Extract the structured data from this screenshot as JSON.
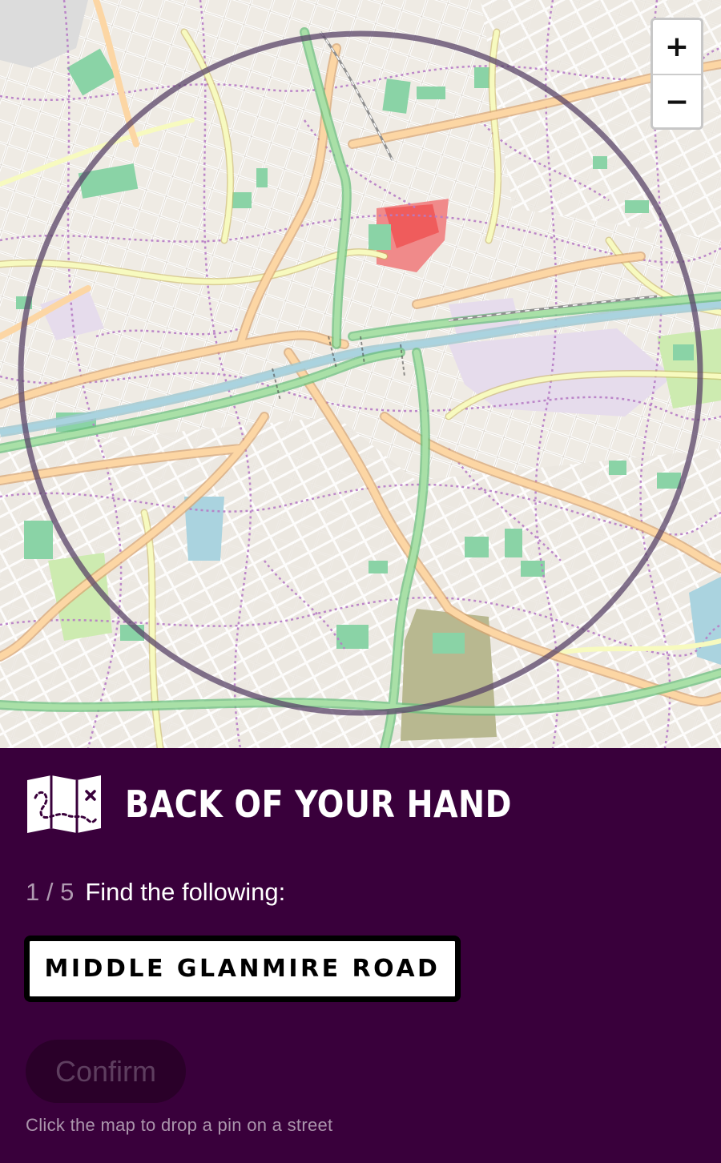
{
  "map": {
    "zoom_in_label": "+",
    "zoom_out_label": "−"
  },
  "app": {
    "title": "BACK OF YOUR HAND"
  },
  "quiz": {
    "progress": "1 / 5",
    "prompt": "Find the following:",
    "target": "MIDDLE GLANMIRE ROAD",
    "confirm_label": "Confirm",
    "confirm_disabled": true,
    "hint": "Click the map to drop a pin on a street"
  },
  "colors": {
    "panel_bg": "#39003b",
    "counter_text": "#b09ab1",
    "hint_text": "#ab95ac",
    "confirm_bg": "#2a0029",
    "confirm_text": "#5e3e5f",
    "map_circle": "#5a4468"
  }
}
